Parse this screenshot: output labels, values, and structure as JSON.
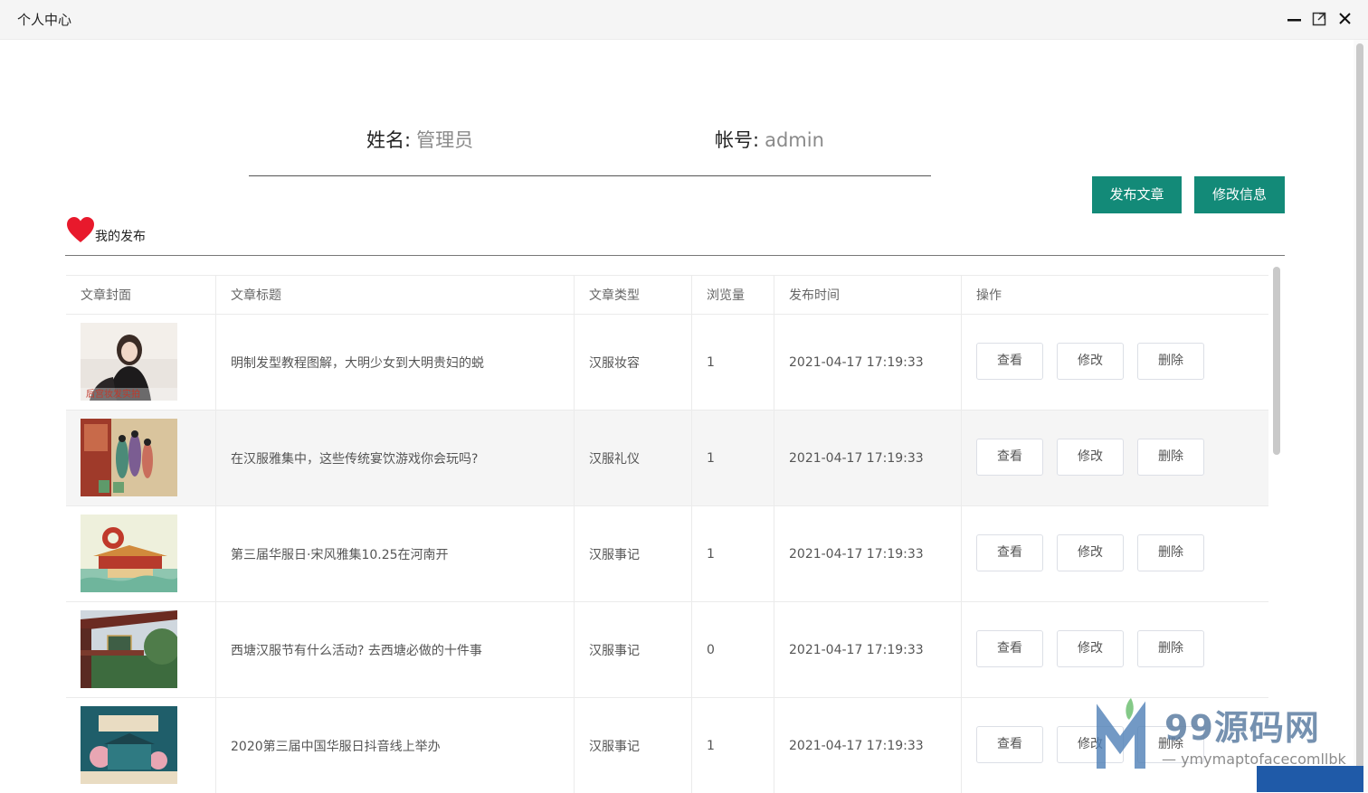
{
  "window": {
    "title": "个人中心"
  },
  "profile": {
    "name_label": "姓名:",
    "name_value": "管理员",
    "account_label": "帐号:",
    "account_value": "admin"
  },
  "actions": {
    "publish_label": "发布文章",
    "edit_info_label": "修改信息"
  },
  "section": {
    "title": "我的发布"
  },
  "table": {
    "columns": [
      "文章封面",
      "文章标题",
      "文章类型",
      "浏览量",
      "发布时间",
      "操作"
    ],
    "rows": [
      {
        "title": "明制发型教程图解，大明少女到大明贵妇的蜕",
        "type": "汉服妆容",
        "views": "1",
        "time": "2021-04-17 17:19:33",
        "view_label": "查看",
        "edit_label": "修改",
        "delete_label": "删除"
      },
      {
        "title": "在汉服雅集中，这些传统宴饮游戏你会玩吗?",
        "type": "汉服礼仪",
        "views": "1",
        "time": "2021-04-17 17:19:33",
        "view_label": "查看",
        "edit_label": "修改",
        "delete_label": "删除"
      },
      {
        "title": "第三届华服日·宋风雅集10.25在河南开",
        "type": "汉服事记",
        "views": "1",
        "time": "2021-04-17 17:19:33",
        "view_label": "查看",
        "edit_label": "修改",
        "delete_label": "删除"
      },
      {
        "title": "西塘汉服节有什么活动? 去西塘必做的十件事",
        "type": "汉服事记",
        "views": "0",
        "time": "2021-04-17 17:19:33",
        "view_label": "查看",
        "edit_label": "修改",
        "delete_label": "删除"
      },
      {
        "title": "2020第三届中国华服日抖音线上举办",
        "type": "汉服事记",
        "views": "1",
        "time": "2021-04-17 17:19:33",
        "view_label": "查看",
        "edit_label": "修改",
        "delete_label": "删除"
      }
    ]
  },
  "watermark": {
    "brand": "99源码网",
    "sub": "— ymymaptofacecomllbk"
  },
  "colors": {
    "primary": "#138a78",
    "heart": "#e8192c"
  }
}
